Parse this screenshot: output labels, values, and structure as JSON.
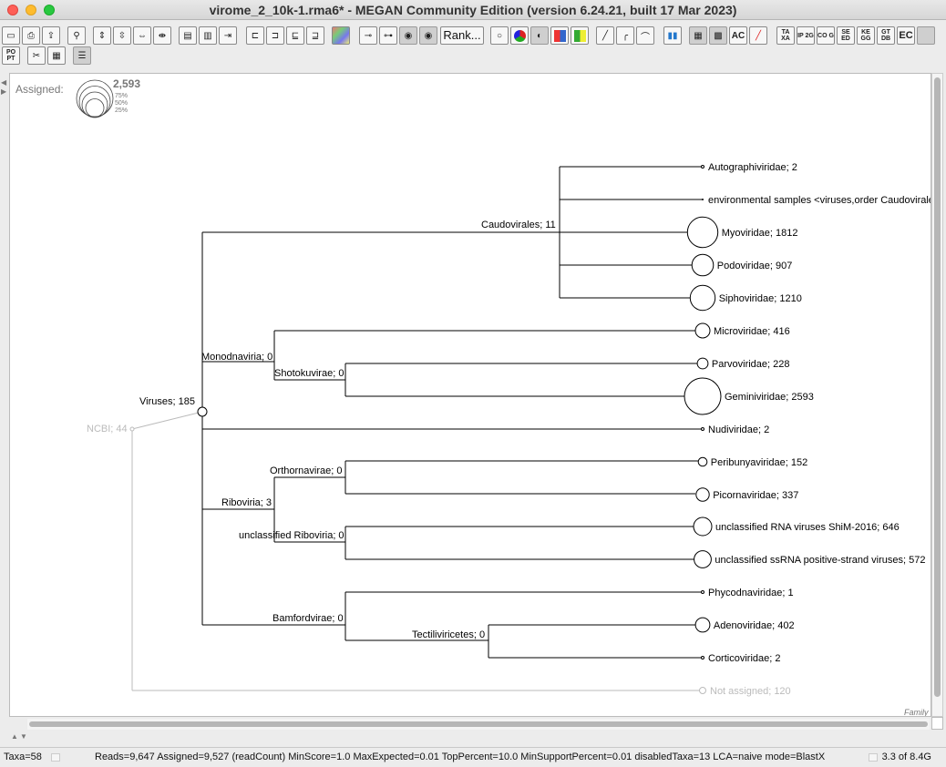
{
  "window": {
    "title": "virome_2_10k-1.rma6* - MEGAN Community Edition (version 6.24.21, built 17 Mar 2023)"
  },
  "toolbar": {
    "rank_label": "Rank...",
    "taxa_glyph": "TA XA",
    "ip2g_glyph": "IP 2G",
    "cog_glyph": "CO G",
    "seed_glyph": "SE ED",
    "kegg_glyph": "KE GG",
    "gtdb_glyph": "GT DB",
    "ec_label": "EC",
    "ac_label": "AC",
    "popt_glyph": "PO PT"
  },
  "legend": {
    "label": "Assigned:",
    "max_value": "2,593",
    "pct_75": "75%",
    "pct_50": "50%",
    "pct_25": "25%"
  },
  "tree": {
    "root": "NCBI; 44",
    "viruses": "Viruses; 185",
    "monodnaviria": "Monodnaviria; 0",
    "shotokuvirae": "Shotokuvirae; 0",
    "riboviria": "Riboviria; 3",
    "orthornavirae": "Orthornavirae; 0",
    "unclassified_riboviria": "unclassified Riboviria; 0",
    "bamfordvirae": "Bamfordvirae; 0",
    "tectiliviricetes": "Tectiliviricetes; 0",
    "caudovirales": "Caudovirales; 11",
    "not_assigned": "Not assigned; 120",
    "leaves": [
      {
        "label": "Autographiviridae; 2",
        "count": 2
      },
      {
        "label": "environmental samples <viruses,order Caudovirales>",
        "count": 0
      },
      {
        "label": "Myoviridae; 1812",
        "count": 1812
      },
      {
        "label": "Podoviridae; 907",
        "count": 907
      },
      {
        "label": "Siphoviridae; 1210",
        "count": 1210
      },
      {
        "label": "Microviridae; 416",
        "count": 416
      },
      {
        "label": "Parvoviridae; 228",
        "count": 228
      },
      {
        "label": "Geminiviridae; 2593",
        "count": 2593
      },
      {
        "label": "Nudiviridae; 2",
        "count": 2
      },
      {
        "label": "Peribunyaviridae; 152",
        "count": 152
      },
      {
        "label": "Picornaviridae; 337",
        "count": 337
      },
      {
        "label": "unclassified RNA viruses ShiM-2016; 646",
        "count": 646
      },
      {
        "label": "unclassified ssRNA positive-strand viruses; 572",
        "count": 572
      },
      {
        "label": "Phycodnaviridae; 1",
        "count": 1
      },
      {
        "label": "Adenoviridae; 402",
        "count": 402
      },
      {
        "label": "Corticoviridae; 2",
        "count": 2
      }
    ],
    "rank_corner": "Family"
  },
  "status": {
    "taxa": "Taxa=58",
    "summary": "Reads=9,647 Assigned=9,527 (readCount) MinScore=1.0 MaxExpected=0.01 TopPercent=10.0 MinSupportPercent=0.01 disabledTaxa=13 LCA=naive mode=BlastX",
    "memory": "3.3 of 8.4G"
  }
}
